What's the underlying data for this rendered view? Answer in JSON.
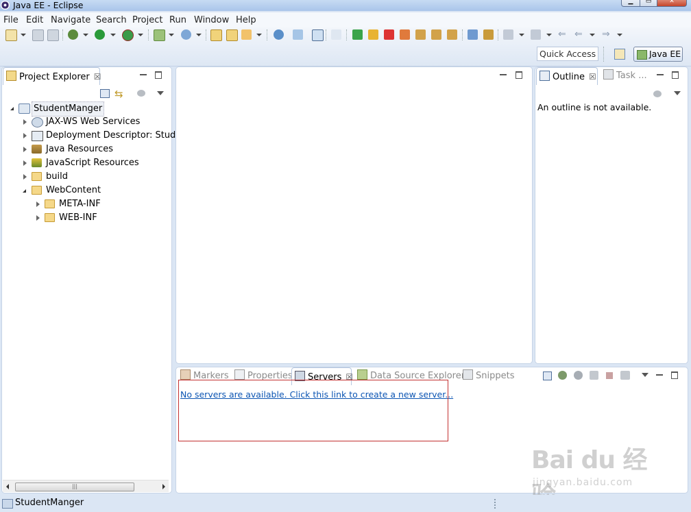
{
  "window": {
    "title": "Java EE - Eclipse"
  },
  "menu": [
    "File",
    "Edit",
    "Navigate",
    "Search",
    "Project",
    "Run",
    "Window",
    "Help"
  ],
  "toolbar": {
    "quick_access_placeholder": "Quick Access",
    "perspective_label": "Java EE"
  },
  "project_explorer": {
    "tab_label": "Project Explorer",
    "tree": [
      {
        "label": "StudentManger",
        "level": 0,
        "state": "open"
      },
      {
        "label": "JAX-WS Web Services",
        "level": 1,
        "state": "closed"
      },
      {
        "label": "Deployment Descriptor: Studen",
        "level": 1,
        "state": "closed"
      },
      {
        "label": "Java Resources",
        "level": 1,
        "state": "closed"
      },
      {
        "label": "JavaScript Resources",
        "level": 1,
        "state": "closed"
      },
      {
        "label": "build",
        "level": 1,
        "state": "closed"
      },
      {
        "label": "WebContent",
        "level": 1,
        "state": "open"
      },
      {
        "label": "META-INF",
        "level": 2,
        "state": "closed"
      },
      {
        "label": "WEB-INF",
        "level": 2,
        "state": "closed"
      }
    ]
  },
  "outline": {
    "tab_label": "Outline",
    "task_tab_label": "Task ...",
    "message": "An outline is not available."
  },
  "bottom_panel": {
    "tabs": [
      "Markers",
      "Properties",
      "Servers",
      "Data Source Explorer",
      "Snippets"
    ],
    "active_tab": "Servers",
    "servers_link": "No servers are available. Click this link to create a new server..."
  },
  "status_bar": {
    "text": "StudentManger"
  },
  "watermark": {
    "brand": "Bai du 经验",
    "url": "jingyan.baidu.com"
  },
  "colors": {
    "link": "#0c55b3",
    "highlight_box": "#c33030",
    "background": "#dbe6f4"
  }
}
